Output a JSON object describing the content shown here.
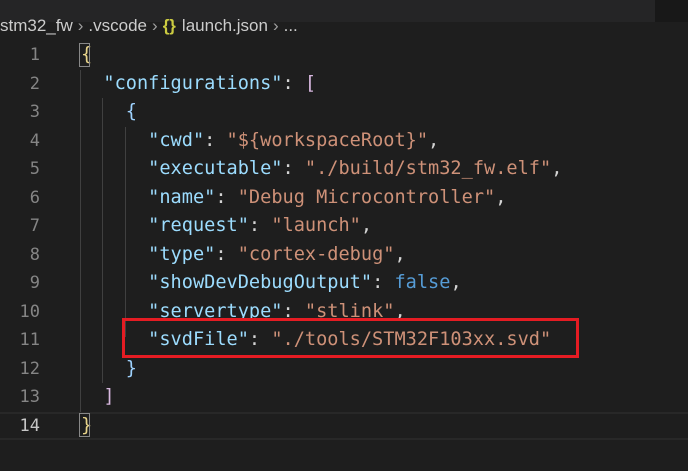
{
  "breadcrumb": [
    "stm32_fw",
    ".vscode",
    "launch.json",
    "..."
  ],
  "icons": {
    "separator": "chevron-right-icon",
    "file": "json-braces-icon"
  },
  "json_icon_glyph": "{}",
  "lines": [
    {
      "n": "1",
      "tokens": [
        [
          "br1",
          "{"
        ]
      ]
    },
    {
      "n": "2",
      "tokens": [
        [
          "",
          "  "
        ],
        [
          "k",
          "\"configurations\""
        ],
        [
          "",
          ": "
        ],
        [
          "br2",
          "["
        ]
      ]
    },
    {
      "n": "3",
      "tokens": [
        [
          "",
          "    "
        ],
        [
          "br3",
          "{"
        ]
      ]
    },
    {
      "n": "4",
      "tokens": [
        [
          "",
          "      "
        ],
        [
          "k",
          "\"cwd\""
        ],
        [
          "",
          ": "
        ],
        [
          "s",
          "\"${workspaceRoot}\""
        ],
        [
          "",
          ","
        ]
      ]
    },
    {
      "n": "5",
      "tokens": [
        [
          "",
          "      "
        ],
        [
          "k",
          "\"executable\""
        ],
        [
          "",
          ": "
        ],
        [
          "s",
          "\"./build/stm32_fw.elf\""
        ],
        [
          "",
          ","
        ]
      ]
    },
    {
      "n": "6",
      "tokens": [
        [
          "",
          "      "
        ],
        [
          "k",
          "\"name\""
        ],
        [
          "",
          ": "
        ],
        [
          "s",
          "\"Debug Microcontroller\""
        ],
        [
          "",
          ","
        ]
      ]
    },
    {
      "n": "7",
      "tokens": [
        [
          "",
          "      "
        ],
        [
          "k",
          "\"request\""
        ],
        [
          "",
          ": "
        ],
        [
          "s",
          "\"launch\""
        ],
        [
          "",
          ","
        ]
      ]
    },
    {
      "n": "8",
      "tokens": [
        [
          "",
          "      "
        ],
        [
          "k",
          "\"type\""
        ],
        [
          "",
          ": "
        ],
        [
          "s",
          "\"cortex-debug\""
        ],
        [
          "",
          ","
        ]
      ]
    },
    {
      "n": "9",
      "tokens": [
        [
          "",
          "      "
        ],
        [
          "k",
          "\"showDevDebugOutput\""
        ],
        [
          "",
          ": "
        ],
        [
          "b",
          "false"
        ],
        [
          "",
          ","
        ]
      ]
    },
    {
      "n": "10",
      "tokens": [
        [
          "",
          "      "
        ],
        [
          "k",
          "\"servertype\""
        ],
        [
          "",
          ": "
        ],
        [
          "s",
          "\"stlink\""
        ],
        [
          "",
          ","
        ]
      ]
    },
    {
      "n": "11",
      "tokens": [
        [
          "",
          "      "
        ],
        [
          "k",
          "\"svdFile\""
        ],
        [
          "",
          ": "
        ],
        [
          "s",
          "\"./tools/STM32F103xx.svd\""
        ]
      ]
    },
    {
      "n": "12",
      "tokens": [
        [
          "",
          "    "
        ],
        [
          "br3",
          "}"
        ]
      ]
    },
    {
      "n": "13",
      "tokens": [
        [
          "",
          "  "
        ],
        [
          "br2",
          "]"
        ]
      ]
    },
    {
      "n": "14",
      "tokens": [
        [
          "br1",
          "}"
        ]
      ],
      "active": true
    }
  ]
}
